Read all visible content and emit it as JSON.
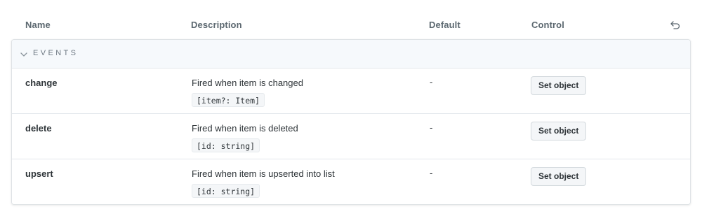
{
  "columns": {
    "name": "Name",
    "description": "Description",
    "default": "Default",
    "control": "Control"
  },
  "reset_icon": "undo-icon",
  "section": {
    "label": "EVENTS",
    "expanded": true,
    "toggle_icon": "chevron-down-icon"
  },
  "rows": [
    {
      "name": "change",
      "description": "Fired when item is changed",
      "type": "[item?: Item]",
      "default": "-",
      "control_label": "Set object"
    },
    {
      "name": "delete",
      "description": "Fired when item is deleted",
      "type": "[id: string]",
      "default": "-",
      "control_label": "Set object"
    },
    {
      "name": "upsert",
      "description": "Fired when item is upserted into list",
      "type": "[id: string]",
      "default": "-",
      "control_label": "Set object"
    }
  ]
}
